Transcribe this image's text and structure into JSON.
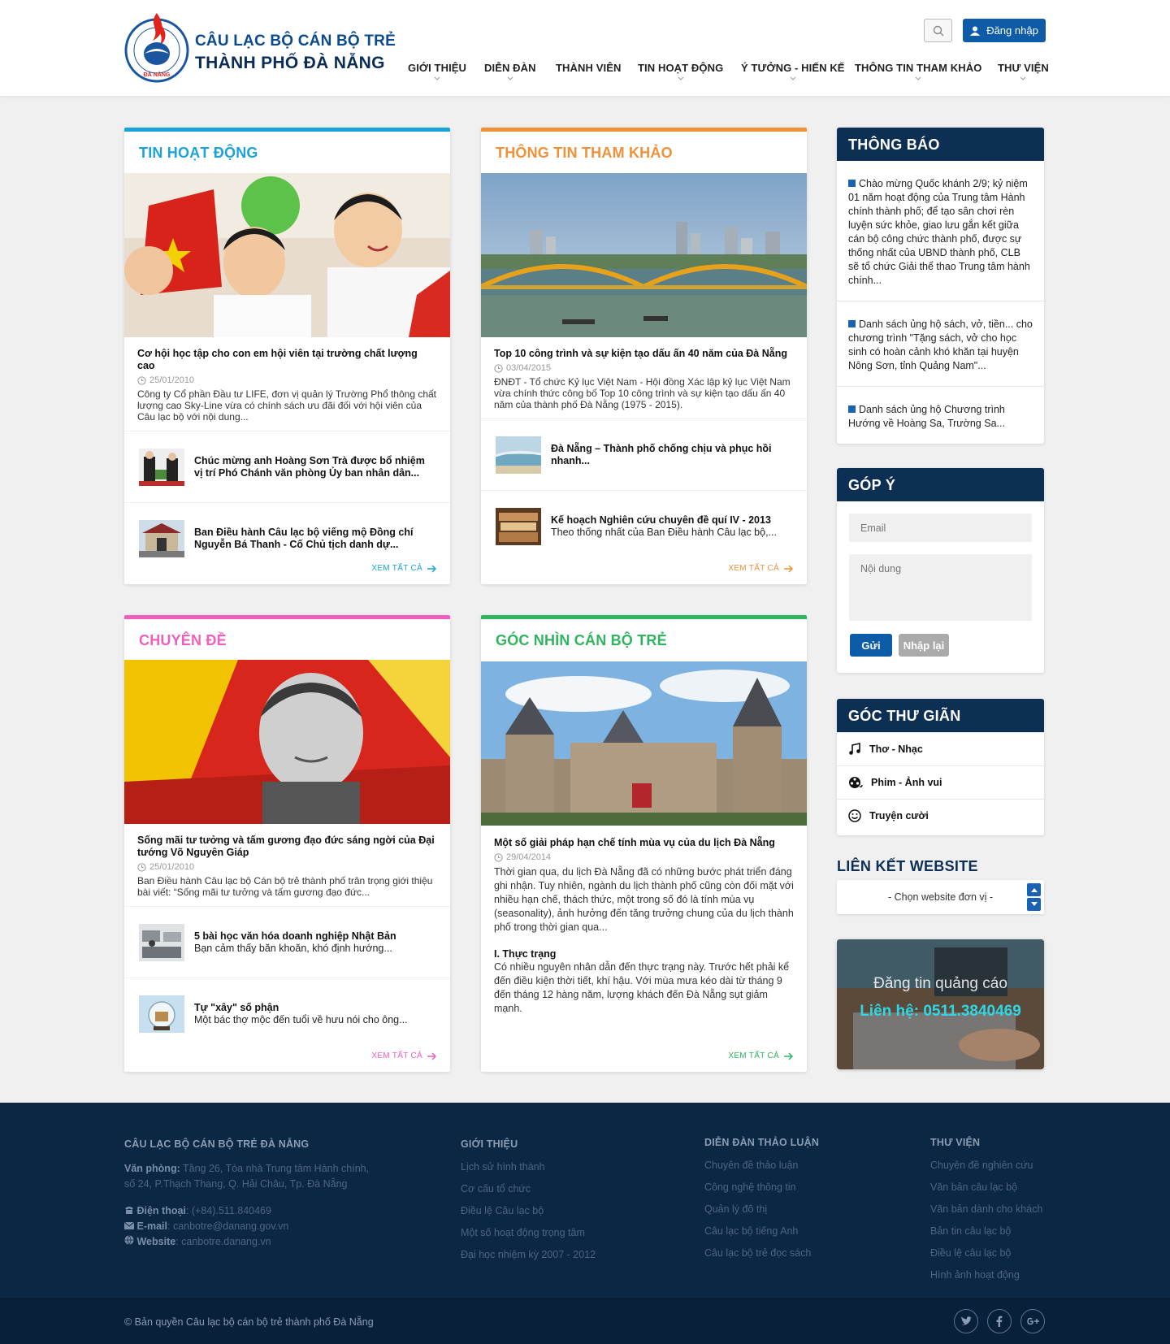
{
  "brand": {
    "line1": "CÂU LẠC BỘ CÁN BỘ TRẺ",
    "line2": "THÀNH PHỐ ĐÀ NẴNG",
    "logo_text": "CÂU LẠC BỘ CÁN BỘ TRẺ ĐÀ NẴNG"
  },
  "header": {
    "login_label": "Đăng nhập",
    "search_icon": "search-icon",
    "user_icon": "user-icon"
  },
  "nav": [
    {
      "label": "GIỚI THIỆU",
      "caret": true
    },
    {
      "label": "DIỄN ĐÀN",
      "caret": true
    },
    {
      "label": "THÀNH VIÊN",
      "caret": false
    },
    {
      "label": "TIN HOẠT ĐỘNG",
      "caret": true
    },
    {
      "label": "Ý TƯỞNG - HIẾN KẾ",
      "caret": true
    },
    {
      "label": "THÔNG TIN THAM KHẢO",
      "caret": true
    },
    {
      "label": "THƯ VIỆN",
      "caret": true
    }
  ],
  "colors": {
    "blue": "#1ba3d9",
    "orange": "#f0913a",
    "pink": "#ef5fbd",
    "green": "#2fb45f",
    "navy": "#0d2f54"
  },
  "sections": {
    "tin": {
      "title": "TIN HOẠT ĐỘNG",
      "feature": {
        "title": "Cơ hội học tập cho con em hội viên tại trường chất lượng cao",
        "date": "25/01/2010",
        "summary": "Công ty Cổ phần Đầu tư LIFE, đơn vị quản lý Trường Phổ thông chất lượng cao Sky-Line vừa có chính sách ưu đãi đối với hội viên của Câu lạc bộ với nội dung..."
      },
      "items": [
        {
          "title": "Chúc mừng anh Hoàng Sơn Trà được bổ nhiệm vị trí Phó Chánh văn phòng Ủy ban nhân dân..."
        },
        {
          "title": "Ban Điều hành Câu lạc bộ viếng mộ Đồng chí Nguyễn Bá Thanh - Cố Chủ tịch danh dự..."
        }
      ],
      "more": "XEM TẤT CẢ"
    },
    "thamkhao": {
      "title": "THÔNG TIN THAM KHẢO",
      "feature": {
        "title": "Top 10 công trình và sự kiện tạo dấu ấn 40 năm của Đà Nẵng",
        "date": "03/04/2015",
        "summary": "ĐNĐT - Tổ chức Kỷ lục Việt Nam - Hội đồng Xác lập kỷ lục Việt Nam vừa chính thức công bố Top 10 công trình và sự kiện tạo dấu ấn 40 năm của thành phố Đà Nẵng (1975 - 2015)."
      },
      "items": [
        {
          "title": "Đà Nẵng – Thành phố chống chịu và phục hồi nhanh..."
        },
        {
          "title": "Kế hoạch Nghiên cứu chuyên đề quí IV - 2013",
          "sub": "Theo thống nhất của Ban Điều hành Câu lạc bộ,..."
        }
      ],
      "more": "XEM TẤT CẢ"
    },
    "chuyende": {
      "title": "CHUYÊN ĐỀ",
      "feature": {
        "title": "Sống mãi tư tưởng và tấm gương đạo đức sáng ngời của Đại tướng Võ Nguyên Giáp",
        "date": "25/01/2010",
        "summary": "Ban Điều hành Câu lạc bộ Cán bộ trẻ thành phố trân trọng giới thiệu bài viết: “Sống mãi tư tưởng và tấm gương đạo đức..."
      },
      "items": [
        {
          "title": "5 bài học văn hóa doanh nghiệp Nhật Bản",
          "sub": "Bạn cảm thấy băn khoăn, khó định hướng..."
        },
        {
          "title": "Tự \"xây\" số phận",
          "sub": "Một bác thợ mộc đến tuổi về hưu nói cho ông..."
        }
      ],
      "more": "XEM TẤT CẢ"
    },
    "gocnhin": {
      "title": "GÓC NHÌN CÁN BỘ TRẺ",
      "feature": {
        "title": "Một số giải pháp hạn chế tính mùa vụ của du lịch Đà Nẵng",
        "date": "29/04/2014",
        "summary": "Thời gian qua, du lịch Đà Nẵng đã có những bước phát triển đáng ghi nhận. Tuy nhiên, ngành du lịch thành phố cũng còn đối mặt với nhiều hạn chế, thách thức, một trong số đó là tính mùa vụ (seasonality), ảnh hưởng đến tăng trưởng chung của du lịch thành phố trong thời gian qua...",
        "subhead": "I. Thực trạng",
        "body2": "Có nhiều nguyên nhân dẫn đến thực trạng này. Trước hết phải kể đến điều kiện thời tiết, khí hậu. Với mùa mưa kéo dài từ tháng 9 đến tháng 12 hàng năm, lượng khách đến Đà Nẵng sụt giảm mạnh."
      },
      "more": "XEM TẤT CẢ"
    }
  },
  "sidebar": {
    "thongbao": {
      "title": "THÔNG BÁO",
      "items": [
        "Chào mừng Quốc khánh 2/9; kỷ niệm 01 năm hoạt động của Trung tâm Hành chính thành phố; để tạo sân chơi rèn luyện sức khỏe, giao lưu gắn kết giữa cán bộ công chức thành phố, được sự thống nhất của UBND thành phố, CLB sẽ tổ chức Giải thể thao Trung tâm hành chính...",
        "Danh sách ủng hộ sách, vở, tiền... cho chương trình \"Tặng sách, vở cho học sinh có hoàn cảnh khó khăn tại huyện Nông Sơn, tỉnh Quảng Nam\"...",
        "Danh sách ủng hộ Chương trình Hướng về Hoàng Sa, Trường Sa..."
      ]
    },
    "gopy": {
      "title": "GÓP Ý",
      "email_placeholder": "Email",
      "content_placeholder": "Nội dung",
      "send": "Gửi",
      "reset": "Nhập lại"
    },
    "gocthugian": {
      "title": "GÓC THƯ GIÃN",
      "items": [
        {
          "label": "Thơ - Nhạc",
          "icon": "music-icon"
        },
        {
          "label": "Phim - Ảnh vui",
          "icon": "film-icon"
        },
        {
          "label": "Truyện cười",
          "icon": "smile-icon"
        }
      ]
    },
    "lienket": {
      "title": "LIÊN KẾT WEBSITE",
      "select": "- Chọn website đơn vị -"
    },
    "ad": {
      "line1": "Đăng tin quảng cáo",
      "line2": "Liên hệ: 0511.3840469"
    }
  },
  "footer": {
    "org": {
      "heading": "CÂU LẠC BỘ CÁN BỘ TRẺ ĐÀ NẴNG",
      "office_label": "Văn phòng:",
      "office": "Tầng 26, Tòa nhà Trung tâm Hành chính, số 24, P.Thạch Thang, Q. Hải Châu, Tp. Đà Nẵng",
      "phone_label": "Điện thoại",
      "phone": ": (+84).511.840469",
      "email_label": "E-mail",
      "email": ": canbotre@danang.gov.vn",
      "web_label": "Website",
      "web": ": canbotre.danang.vn"
    },
    "gioithieu": {
      "heading": "GIỚI THIỆU",
      "links": [
        "Lịch sử hình thành",
        "Cơ cấu tổ chức",
        "Điều lệ Câu lạc bộ",
        "Một số hoạt động trọng tâm",
        "Đại học nhiệm kỳ 2007 - 2012"
      ]
    },
    "diendan": {
      "heading": "DIỄN ĐÀN THẢO LUẬN",
      "links": [
        "Chuyên đề thảo luận",
        "Công nghệ thông tin",
        "Quản lý đô thị",
        "Câu lạc bộ tiếng Anh",
        "Câu lạc bộ trẻ đọc sách"
      ]
    },
    "thuvien": {
      "heading": "THƯ VIỆN",
      "links": [
        "Chuyên đề nghiên cứu",
        "Văn bản câu lạc bộ",
        "Văn bản dành cho khách",
        "Bản tin câu lạc bộ",
        "Điều lệ câu lạc bộ",
        "Hình ảnh hoạt động"
      ]
    },
    "copyright": "© Bản quyền Câu lạc bộ cán bộ trẻ thành phố Đà Nẵng"
  }
}
